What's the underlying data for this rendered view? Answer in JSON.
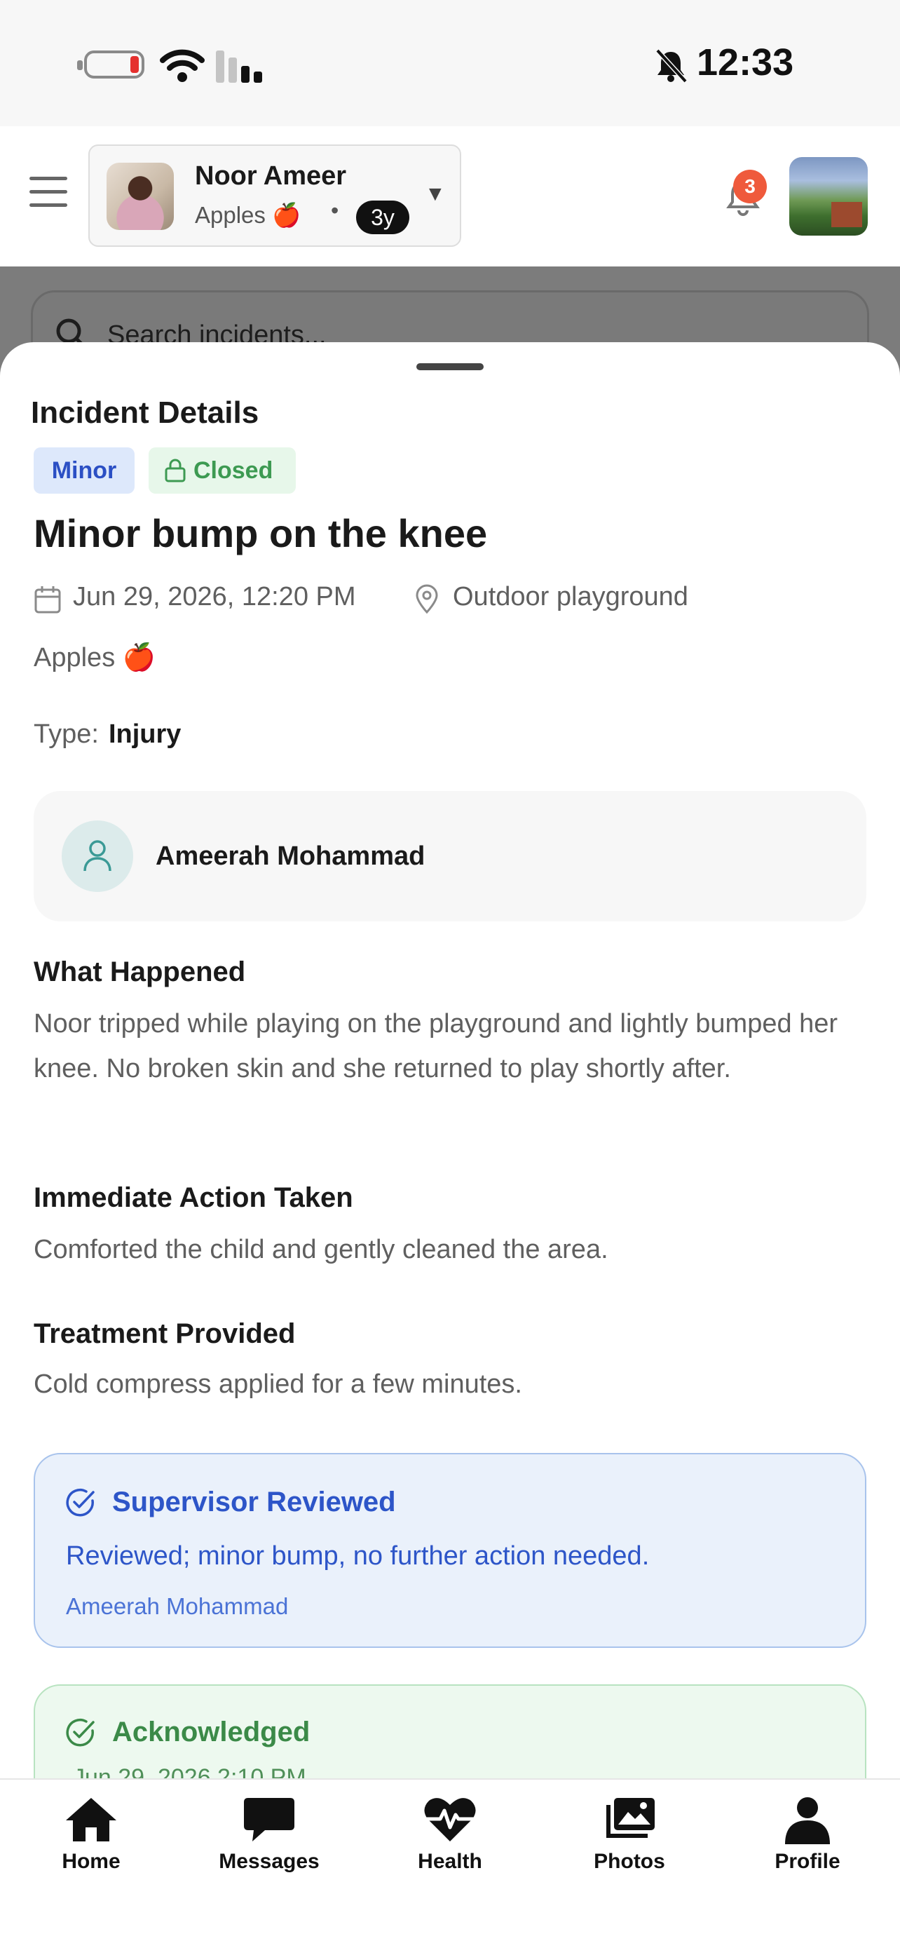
{
  "status_bar": {
    "time": "12:33"
  },
  "header": {
    "child_name": "Noor Ameer",
    "class_name": "Apples 🍎",
    "separator": "•",
    "age": "3y",
    "notification_count": "3"
  },
  "search": {
    "placeholder": "Search incidents..."
  },
  "incident": {
    "sheet_title": "Incident Details",
    "severity": "Minor",
    "status": "Closed",
    "title": "Minor bump on the knee",
    "datetime": "Jun 29, 2026, 12:20 PM",
    "location": "Outdoor playground",
    "class_name": "Apples 🍎",
    "type_label": "Type:",
    "type_value": "Injury",
    "reporter": "Ameerah Mohammad",
    "sections": [
      {
        "heading": "What Happened",
        "body": "Noor tripped while playing on the playground and lightly bumped her knee. No broken skin and she returned to play shortly after."
      },
      {
        "heading": "Immediate Action Taken",
        "body": "Comforted the child and gently cleaned the area."
      },
      {
        "heading": "Treatment Provided",
        "body": "Cold compress applied for a few minutes."
      }
    ],
    "review": {
      "title": "Supervisor Reviewed",
      "note": "Reviewed; minor bump, no further action needed.",
      "reviewer": "Ameerah Mohammad"
    },
    "acknowledgement": {
      "title": "Acknowledged",
      "datetime": "Jun 29, 2026 2:10 PM"
    }
  },
  "tabs": [
    {
      "label": "Home",
      "icon": "home-icon"
    },
    {
      "label": "Messages",
      "icon": "chat-bubble-icon"
    },
    {
      "label": "Health",
      "icon": "heart-pulse-icon"
    },
    {
      "label": "Photos",
      "icon": "photo-stack-icon"
    },
    {
      "label": "Profile",
      "icon": "person-icon"
    }
  ],
  "colors": {
    "severity_bg": "#dde8fb",
    "severity_text": "#2b4fc4",
    "closed_bg": "#e7f7ea",
    "closed_text": "#3d9a52",
    "review_accent": "#2d55c8",
    "ack_accent": "#3b8a48",
    "notification_badge": "#ef5a3c"
  }
}
